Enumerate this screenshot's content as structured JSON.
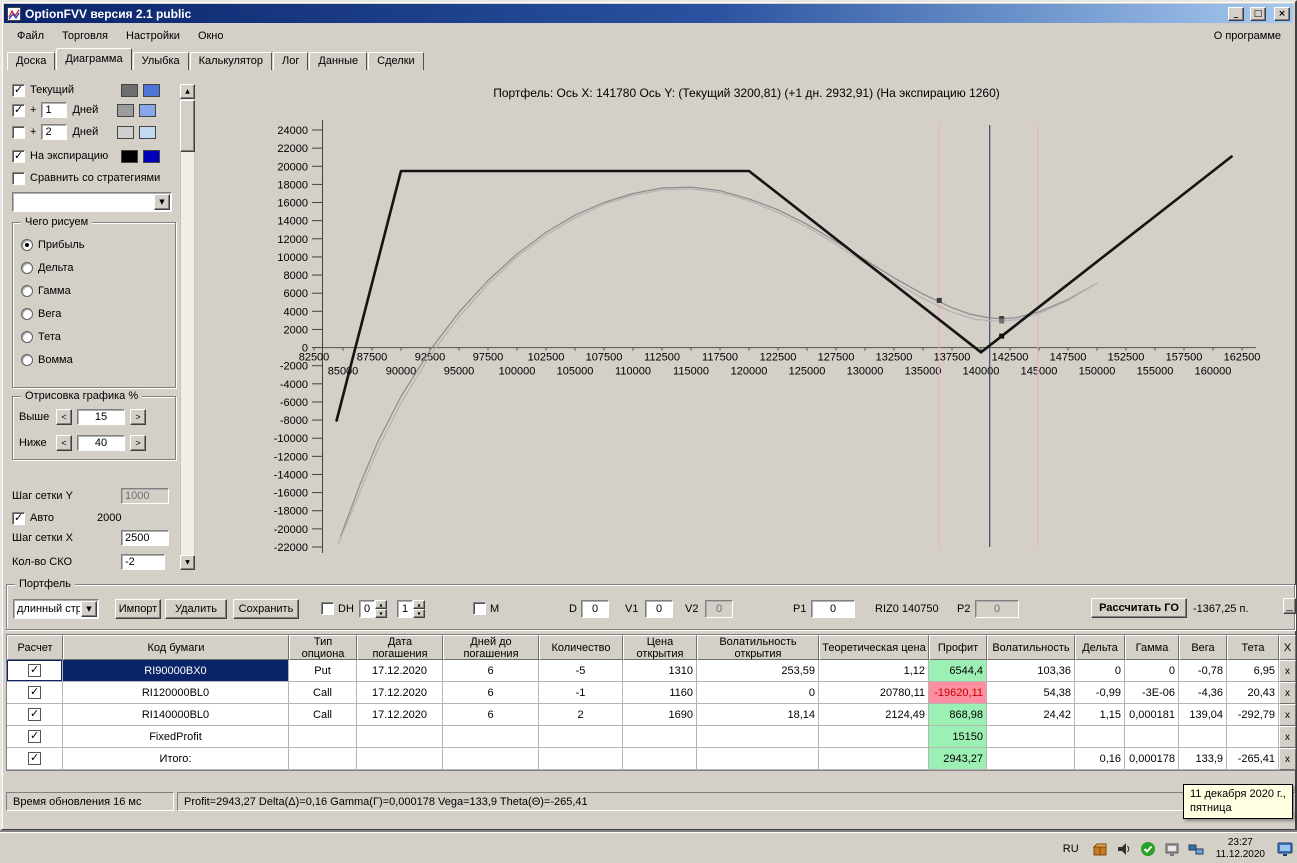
{
  "window": {
    "title": "OptionFVV версия 2.1 public",
    "buttons": {
      "minimize": "_",
      "maximize": "□",
      "close": "×"
    }
  },
  "menu": {
    "items": [
      "Файл",
      "Торговля",
      "Настройки",
      "Окно"
    ],
    "right": "О программе"
  },
  "tabs": {
    "items": [
      "Доска",
      "Диаграмма",
      "Улыбка",
      "Калькулятор",
      "Лог",
      "Данные",
      "Сделки"
    ],
    "active": "Диаграмма"
  },
  "left_panel": {
    "current": {
      "label": "Текущий",
      "checked": true,
      "swatch1": "#6e6e6e",
      "swatch2": "#4f74d8"
    },
    "plus1": {
      "prefix": "+",
      "value": "1",
      "label": "Дней",
      "checked": true,
      "swatch1": "#9c9c9c",
      "swatch2": "#86a7ea"
    },
    "plus2": {
      "prefix": "+",
      "value": "2",
      "label": "Дней",
      "checked": false,
      "swatch1": "#cfcfcf",
      "swatch2": "#c2daf4"
    },
    "expiry": {
      "label": "На экспирацию",
      "checked": true,
      "swatch1": "#000000",
      "swatch2": "#0000bb"
    },
    "compare": {
      "label": "Сравнить со стратегиями",
      "checked": false
    },
    "strategy_combo": "",
    "draw_group": {
      "title": "Чего рисуем",
      "options": [
        "Прибыль",
        "Дельта",
        "Гамма",
        "Вега",
        "Тета",
        "Вомма"
      ],
      "selected": "Прибыль"
    },
    "render_group": {
      "title": "Отрисовка графика %",
      "above_label": "Выше",
      "above_value": "15",
      "below_label": "Ниже",
      "below_value": "40"
    },
    "grid_y": {
      "label": "Шаг сетки Y",
      "value": "1000"
    },
    "auto": {
      "label": "Авто",
      "checked": true,
      "value": "2000"
    },
    "grid_x": {
      "label": "Шаг сетки X",
      "value": "2500"
    },
    "sko": {
      "label": "Кол-во СКО",
      "value": "-2"
    }
  },
  "chart_data": {
    "type": "line",
    "title": "Портфель:  Ось X: 141780 Ось Y:   (Текущий 3200,81)  (+1 дн. 2932,91)  (На экспирацию 1260)",
    "x_range": [
      82500,
      162500
    ],
    "y_range": [
      -22000,
      24000
    ],
    "y_step": 2000,
    "x_step": 2500,
    "grid": false,
    "series": [
      {
        "name": "Текущий",
        "color": "#8c8c8c",
        "width": 1.2,
        "points": [
          [
            84800,
            -20800
          ],
          [
            86500,
            -15000
          ],
          [
            88000,
            -10400
          ],
          [
            90000,
            -5400
          ],
          [
            92500,
            -300
          ],
          [
            95000,
            3900
          ],
          [
            97500,
            7400
          ],
          [
            100000,
            10300
          ],
          [
            102500,
            12700
          ],
          [
            105000,
            14600
          ],
          [
            107500,
            16000
          ],
          [
            110000,
            17000
          ],
          [
            112500,
            17600
          ],
          [
            115000,
            17700
          ],
          [
            117500,
            17300
          ],
          [
            120000,
            16400
          ],
          [
            122500,
            15200
          ],
          [
            125000,
            13600
          ],
          [
            127500,
            11700
          ],
          [
            130000,
            9700
          ],
          [
            132500,
            7700
          ],
          [
            135000,
            5900
          ],
          [
            137500,
            4400
          ],
          [
            139000,
            3700
          ],
          [
            140750,
            3260
          ],
          [
            141780,
            3200
          ],
          [
            143000,
            3300
          ],
          [
            145000,
            3950
          ],
          [
            147500,
            5300
          ],
          [
            150000,
            7100
          ]
        ]
      },
      {
        "name": "+1 Дней",
        "color": "#b2b2b2",
        "width": 1.2,
        "points": [
          [
            84600,
            -21600
          ],
          [
            86500,
            -15800
          ],
          [
            88000,
            -11200
          ],
          [
            90000,
            -6100
          ],
          [
            92500,
            -900
          ],
          [
            95000,
            3400
          ],
          [
            97500,
            7000
          ],
          [
            100000,
            10000
          ],
          [
            102500,
            12400
          ],
          [
            105000,
            14300
          ],
          [
            107500,
            15800
          ],
          [
            110000,
            16800
          ],
          [
            112500,
            17400
          ],
          [
            115000,
            17500
          ],
          [
            117500,
            17100
          ],
          [
            120000,
            16200
          ],
          [
            122500,
            14900
          ],
          [
            125000,
            13300
          ],
          [
            127500,
            11400
          ],
          [
            130000,
            9300
          ],
          [
            132500,
            7300
          ],
          [
            135000,
            5400
          ],
          [
            137500,
            3900
          ],
          [
            139500,
            3100
          ],
          [
            141000,
            2950
          ],
          [
            141780,
            2930
          ],
          [
            143000,
            3050
          ],
          [
            145000,
            3750
          ],
          [
            147500,
            5200
          ],
          [
            150000,
            7100
          ]
        ]
      },
      {
        "name": "На экспирацию",
        "color": "#141414",
        "width": 2.6,
        "points": [
          [
            84450,
            -8050
          ],
          [
            90000,
            19480
          ],
          [
            120000,
            19480
          ],
          [
            140000,
            -520
          ],
          [
            161600,
            21080
          ]
        ]
      }
    ],
    "vlines": [
      {
        "x": 136400,
        "color": "#efaec6"
      },
      {
        "x": 140750,
        "color": "#3c4a74"
      },
      {
        "x": 144900,
        "color": "#efaec6"
      }
    ],
    "markers": [
      {
        "x": 136400,
        "y": 5200,
        "color": "#3a3a3a"
      },
      {
        "x": 141780,
        "y": 3200,
        "color": "#3a3a3a"
      },
      {
        "x": 141780,
        "y": 2932,
        "color": "#707070"
      },
      {
        "x": 141780,
        "y": 1260,
        "color": "#101010"
      }
    ]
  },
  "portfolio": {
    "group_label": "Портфель",
    "combo_value": "длинный стре",
    "buttons": [
      "Импорт",
      "Удалить",
      "Сохранить"
    ],
    "dh_label": "DH",
    "dh_checked": false,
    "spin1": "0",
    "spin2": "1",
    "m_label": "M",
    "m_checked": false,
    "d_label": "D",
    "d_value": "0",
    "v1_label": "V1",
    "v1_value": "0",
    "v2_label": "V2",
    "v2_value": "0",
    "p1_label": "P1",
    "p1_value": "0",
    "ticker": "RIZ0 140750",
    "p2_label": "P2",
    "p2_value": "0",
    "calc_button": "Рассчитать ГО",
    "margin_value": "-1367,25 п.",
    "mini_button": "_"
  },
  "table": {
    "columns": [
      "Расчет",
      "Код бумаги",
      "Тип опциона",
      "Дата погашения",
      "Дней до погашения",
      "Количество",
      "Цена открытия",
      "Волатильность открытия",
      "Теоретическая цена",
      "Профит",
      "Волатильность",
      "Дельта",
      "Гамма",
      "Вега",
      "Тета",
      "X"
    ],
    "x_button": "x",
    "rows": [
      {
        "checked": true,
        "code": "RI90000BX0",
        "code_selected": true,
        "values": [
          "Put",
          "17.12.2020",
          "6",
          "-5",
          "1310",
          "253,59",
          "1,12",
          "6544,4",
          "103,36",
          "0",
          "0",
          "-0,78",
          "6,95"
        ],
        "profit": "pos"
      },
      {
        "checked": true,
        "code": "RI120000BL0",
        "code_selected": false,
        "values": [
          "Call",
          "17.12.2020",
          "6",
          "-1",
          "1160",
          "0",
          "20780,11",
          "-19620,11",
          "54,38",
          "-0,99",
          "-3E-06",
          "-4,36",
          "20,43"
        ],
        "profit": "neg"
      },
      {
        "checked": true,
        "code": "RI140000BL0",
        "code_selected": false,
        "values": [
          "Call",
          "17.12.2020",
          "6",
          "2",
          "1690",
          "18,14",
          "2124,49",
          "868,98",
          "24,42",
          "1,15",
          "0,000181",
          "139,04",
          "-292,79"
        ],
        "profit": "pos"
      },
      {
        "checked": true,
        "code": "FixedProfit",
        "code_selected": false,
        "values": [
          "",
          "",
          "",
          "",
          "",
          "",
          "",
          "15150",
          "",
          "",
          "",
          "",
          ""
        ],
        "profit": "pos"
      },
      {
        "checked": true,
        "code": "Итого:",
        "code_selected": false,
        "values": [
          "",
          "",
          "",
          "",
          "",
          "",
          "",
          "2943,27",
          "",
          "0,16",
          "0,000178",
          "133,9",
          "-265,41"
        ],
        "profit": "pos"
      }
    ]
  },
  "status": {
    "left": "Время обновления 16 мс",
    "right": "Profit=2943,27 Delta(Δ)=0,16 Gamma(Γ)=0,000178 Vega=133,9 Theta(Θ)=-265,41"
  },
  "tooltip": {
    "line1": "11 декабря 2020 г.,",
    "line2": "пятница"
  },
  "taskbar": {
    "lang": "RU",
    "time": "23:27",
    "date": "11.12.2020"
  },
  "colors": {
    "titlebar_start": "#0a246a",
    "titlebar_end": "#a6caf0",
    "chrome": "#d4d0c8",
    "profit_pos_bg": "#9df0b4",
    "profit_neg_bg": "#ff8fa0",
    "selection": "#0a246a",
    "tooltip_bg": "#ffffe1"
  }
}
